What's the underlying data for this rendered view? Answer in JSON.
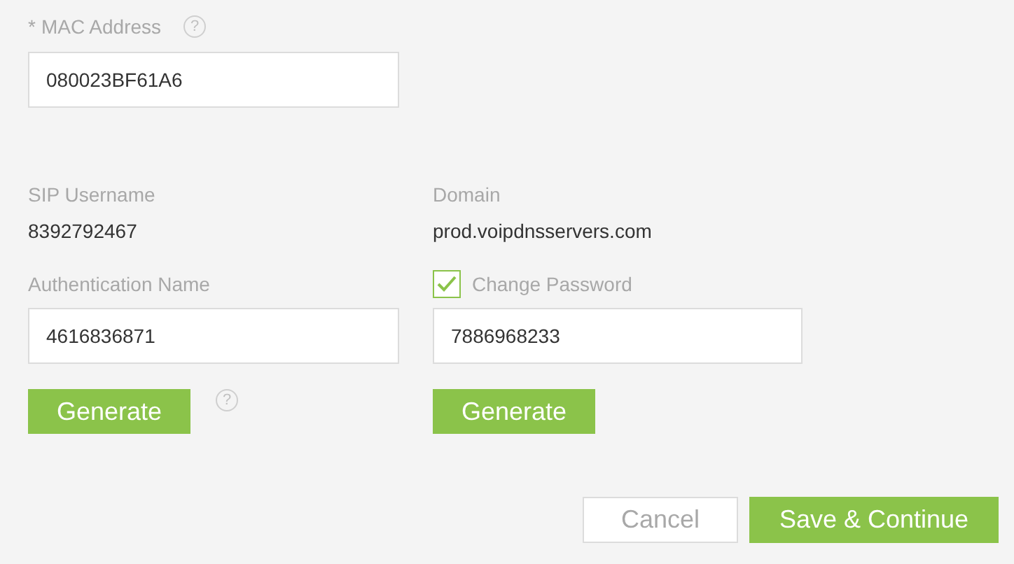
{
  "mac": {
    "required_mark": "*",
    "label": "MAC Address",
    "help": "?",
    "value": "080023BF61A6"
  },
  "sip_username": {
    "label": "SIP Username",
    "value": "8392792467"
  },
  "domain": {
    "label": "Domain",
    "value": "prod.voipdnsservers.com"
  },
  "authentication": {
    "label": "Authentication Name",
    "value": "4616836871",
    "button": "Generate",
    "help": "?"
  },
  "password": {
    "label": "Change Password",
    "checked": true,
    "value": "7886968233",
    "button": "Generate"
  },
  "buttons": [
    {
      "label": "Cancel",
      "kind": "secondary"
    },
    {
      "label": "Save & Continue",
      "kind": "primary"
    }
  ]
}
